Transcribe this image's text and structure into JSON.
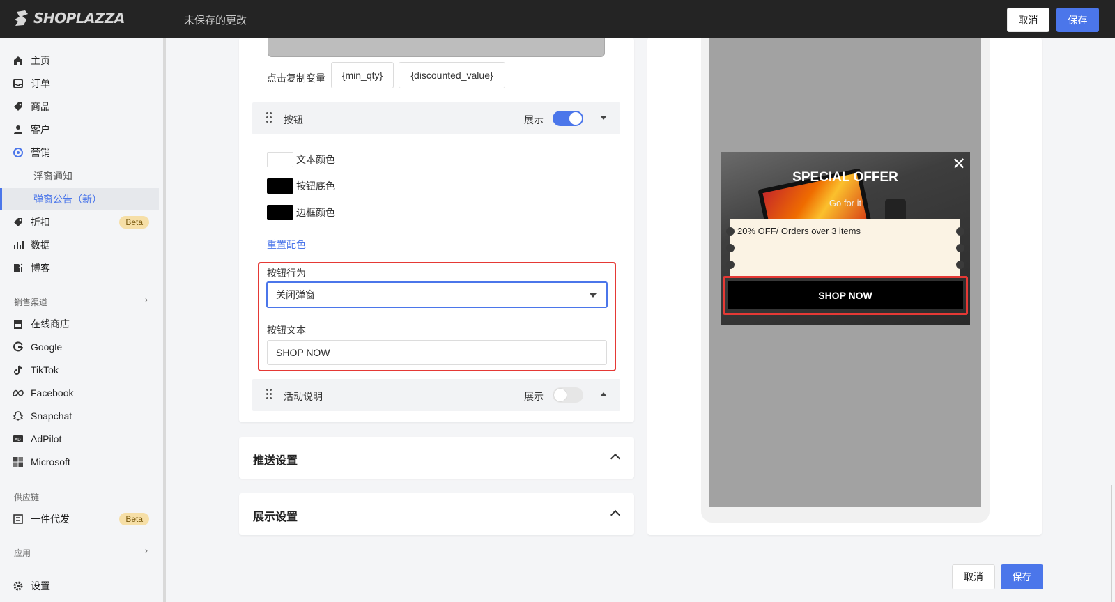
{
  "topbar": {
    "logo_text": "SHOPLAZZA",
    "unsaved_text": "未保存的更改",
    "cancel_label": "取消",
    "save_label": "保存"
  },
  "sidebar": {
    "items": [
      {
        "label": "主页",
        "icon": "home-icon"
      },
      {
        "label": "订单",
        "icon": "inbox-icon"
      },
      {
        "label": "商品",
        "icon": "tag-icon"
      },
      {
        "label": "客户",
        "icon": "person-icon"
      },
      {
        "label": "营销",
        "icon": "target-icon"
      }
    ],
    "sub_items": [
      {
        "label": "浮窗通知",
        "active": false
      },
      {
        "label": "弹窗公告（新）",
        "active": true
      }
    ],
    "items2": [
      {
        "label": "折扣",
        "icon": "discount-icon",
        "badge": "Beta"
      },
      {
        "label": "数据",
        "icon": "bar-chart-icon"
      },
      {
        "label": "博客",
        "icon": "blog-icon"
      }
    ],
    "sales_channels_label": "销售渠道",
    "channels": [
      {
        "label": "在线商店",
        "icon": "store-icon"
      },
      {
        "label": "Google",
        "icon": "google-icon"
      },
      {
        "label": "TikTok",
        "icon": "tiktok-icon"
      },
      {
        "label": "Facebook",
        "icon": "meta-icon"
      },
      {
        "label": "Snapchat",
        "icon": "snapchat-icon"
      },
      {
        "label": "AdPilot",
        "icon": "adpilot-icon"
      },
      {
        "label": "Microsoft",
        "icon": "microsoft-icon"
      }
    ],
    "supply_label": "供应链",
    "supply_item": {
      "label": "一件代发",
      "badge": "Beta"
    },
    "apps_label": "应用",
    "settings_label": "设置"
  },
  "editor": {
    "copy_var_label": "点击复制变量",
    "chips": [
      "{min_qty}",
      "{discounted_value}"
    ],
    "button_section": {
      "title": "按钮",
      "show_label": "展示",
      "enabled": true
    },
    "colors": [
      {
        "label": "文本颜色",
        "color": "#ffffff"
      },
      {
        "label": "按钮底色",
        "color": "#000000"
      },
      {
        "label": "边框颜色",
        "color": "#000000"
      }
    ],
    "reset_label": "重置配色",
    "behavior_label": "按钮行为",
    "behavior_value": "关闭弹窗",
    "text_label": "按钮文本",
    "text_value": "SHOP NOW",
    "activity_section": {
      "title": "活动说明",
      "show_label": "展示",
      "enabled": false
    },
    "push_settings_label": "推送设置",
    "display_settings_label": "展示设置"
  },
  "preview": {
    "title": "SPECIAL OFFER",
    "subtitle": "Go for it",
    "offer_text": "20% OFF/ Orders over 3 items",
    "button_text": "SHOP NOW"
  },
  "footer": {
    "cancel_label": "取消",
    "save_label": "保存"
  },
  "colors": {
    "accent": "#4b76ea",
    "highlight": "#e53935",
    "topbar": "#242424",
    "badge": "#f6dfa7"
  }
}
